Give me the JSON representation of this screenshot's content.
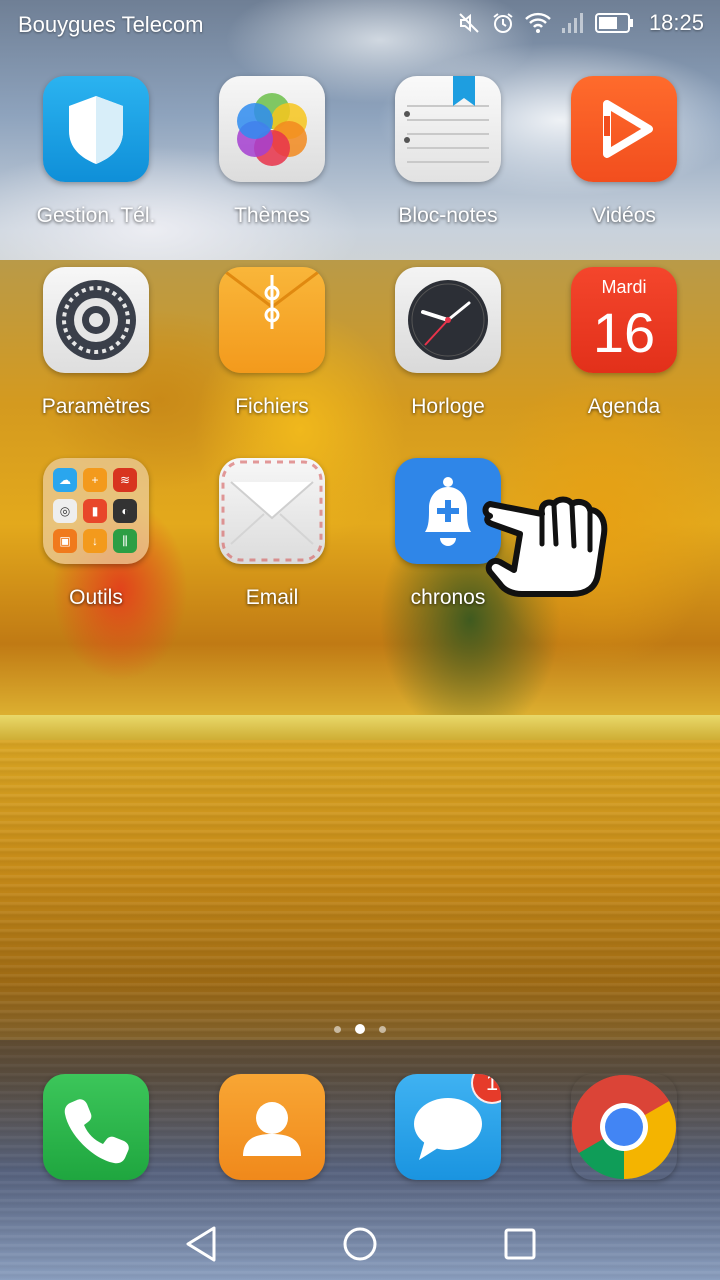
{
  "status_bar": {
    "carrier": "Bouygues Telecom",
    "time": "18:25",
    "icons": [
      "mute-icon",
      "alarm-icon",
      "wifi-icon",
      "signal-icon",
      "battery-icon"
    ]
  },
  "apps": [
    {
      "label": "Gestion. Tél.",
      "icon": "shield-icon"
    },
    {
      "label": "Thèmes",
      "icon": "themes-icon"
    },
    {
      "label": "Bloc-notes",
      "icon": "notepad-icon"
    },
    {
      "label": "Vidéos",
      "icon": "video-play-icon"
    },
    {
      "label": "Paramètres",
      "icon": "gear-icon"
    },
    {
      "label": "Fichiers",
      "icon": "folder-envelope-icon"
    },
    {
      "label": "Horloge",
      "icon": "clock-icon"
    },
    {
      "label": "Agenda",
      "icon": "calendar-icon",
      "day": "Mardi",
      "date": "16"
    },
    {
      "label": "Outils",
      "icon": "tools-folder-icon"
    },
    {
      "label": "Email",
      "icon": "envelope-icon"
    },
    {
      "label": "chronos",
      "icon": "bell-plus-icon"
    }
  ],
  "dock": [
    {
      "icon": "phone-icon"
    },
    {
      "icon": "contacts-icon"
    },
    {
      "icon": "messages-icon",
      "badge": "1"
    },
    {
      "icon": "chrome-icon"
    }
  ],
  "pages": {
    "count": 3,
    "active": 2
  },
  "colors": {
    "chronos_blue": "#2f86e8",
    "badge_red": "#e63b2a",
    "agenda_red": "#e2301a"
  }
}
